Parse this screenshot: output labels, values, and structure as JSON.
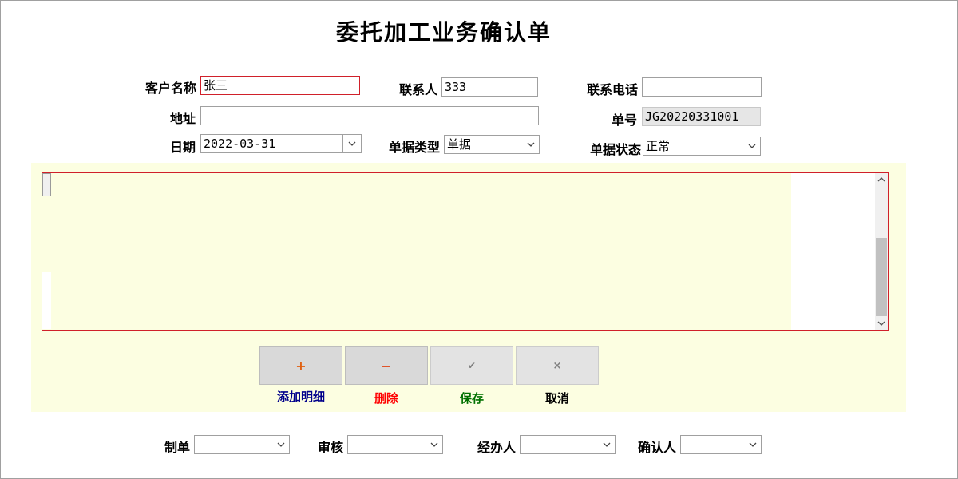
{
  "title": "委托加工业务确认单",
  "header": {
    "customer_label": "客户名称",
    "customer_value": "张三",
    "contact_label": "联系人",
    "contact_value": "333",
    "phone_label": "联系电话",
    "phone_value": "",
    "address_label": "地址",
    "address_value": "",
    "order_no_label": "单号",
    "order_no_value": "JG20220331001",
    "date_label": "日期",
    "date_value": "2022-03-31",
    "doc_type_label": "单据类型",
    "doc_type_value": "单据",
    "doc_status_label": "单据状态",
    "doc_status_value": "正常"
  },
  "actions": {
    "add_symbol": "+",
    "add_label": "添加明细",
    "delete_symbol": "−",
    "delete_label": "删除",
    "save_symbol": "✔",
    "save_label": "保存",
    "cancel_symbol": "×",
    "cancel_label": "取消"
  },
  "footer": {
    "maker_label": "制单",
    "maker_value": "",
    "reviewer_label": "审核",
    "reviewer_value": "",
    "handler_label": "经办人",
    "handler_value": "",
    "confirmer_label": "确认人",
    "confirmer_value": ""
  },
  "colors": {
    "panel_bg": "#fcfee1",
    "grid_border": "#d0202a",
    "add_color": "#00008b",
    "delete_color": "#ff0000",
    "save_color": "#007000",
    "cancel_color": "#000000",
    "add_symbol_color": "#e06010",
    "delete_symbol_color": "#e04010"
  }
}
